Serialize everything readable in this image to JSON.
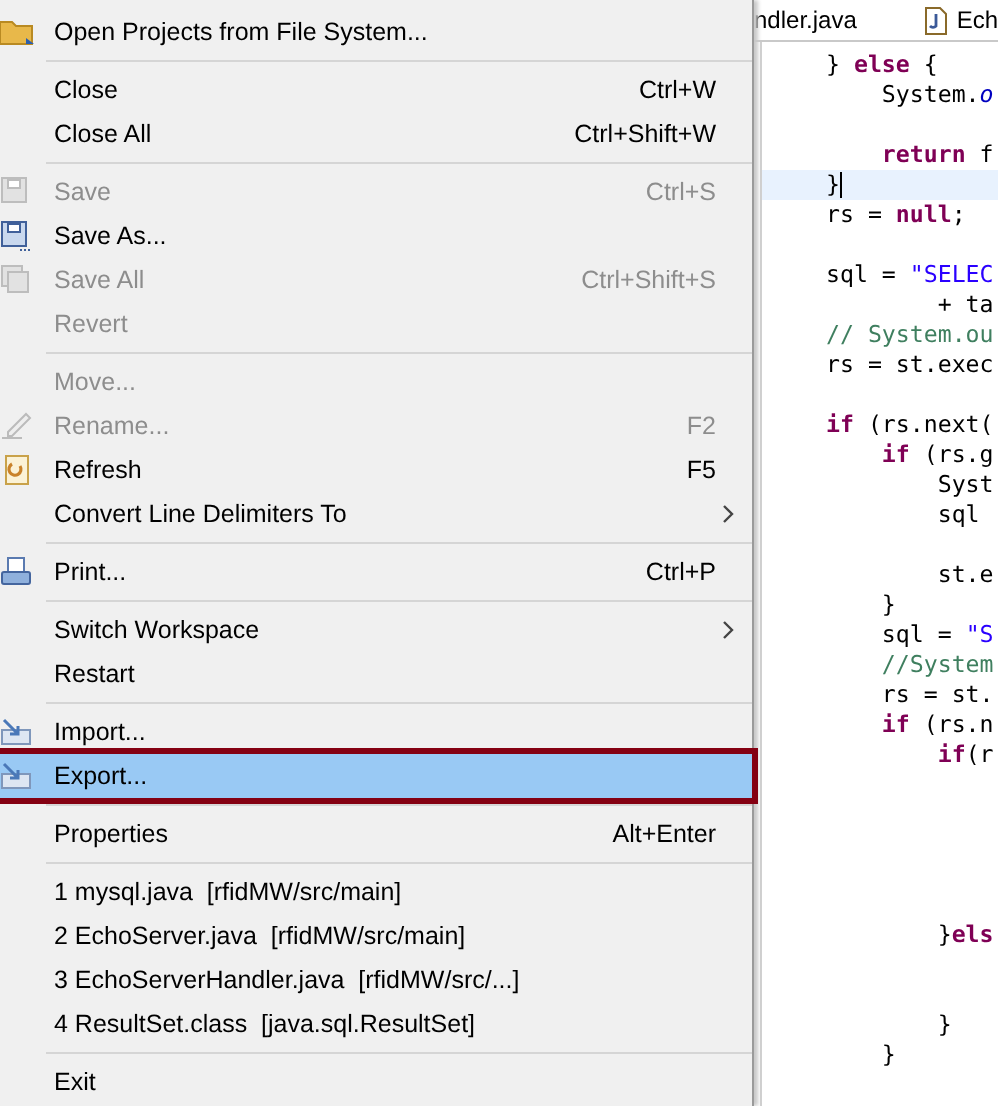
{
  "menu": {
    "sections": [
      [
        {
          "label": "Open Projects from File System...",
          "disabled": false,
          "selected": false,
          "submenu": false
        }
      ],
      [
        {
          "label": "Close",
          "shortcut": "Ctrl+W",
          "disabled": false,
          "selected": false,
          "submenu": false
        },
        {
          "label": "Close All",
          "shortcut": "Ctrl+Shift+W",
          "disabled": false,
          "selected": false,
          "submenu": false
        }
      ],
      [
        {
          "label": "Save",
          "shortcut": "Ctrl+S",
          "disabled": true,
          "selected": false,
          "submenu": false
        },
        {
          "label": "Save As...",
          "disabled": false,
          "selected": false,
          "submenu": false
        },
        {
          "label": "Save All",
          "shortcut": "Ctrl+Shift+S",
          "disabled": true,
          "selected": false,
          "submenu": false
        },
        {
          "label": "Revert",
          "disabled": true,
          "selected": false,
          "submenu": false
        }
      ],
      [
        {
          "label": "Move...",
          "disabled": true,
          "selected": false,
          "submenu": false
        },
        {
          "label": "Rename...",
          "shortcut": "F2",
          "disabled": true,
          "selected": false,
          "submenu": false
        },
        {
          "label": "Refresh",
          "shortcut": "F5",
          "disabled": false,
          "selected": false,
          "submenu": false
        },
        {
          "label": "Convert Line Delimiters To",
          "disabled": false,
          "selected": false,
          "submenu": true
        }
      ],
      [
        {
          "label": "Print...",
          "shortcut": "Ctrl+P",
          "disabled": false,
          "selected": false,
          "submenu": false
        }
      ],
      [
        {
          "label": "Switch Workspace",
          "disabled": false,
          "selected": false,
          "submenu": true
        },
        {
          "label": "Restart",
          "disabled": false,
          "selected": false,
          "submenu": false
        }
      ],
      [
        {
          "label": "Import...",
          "disabled": false,
          "selected": false,
          "submenu": false
        },
        {
          "label": "Export...",
          "disabled": false,
          "selected": true,
          "submenu": false
        }
      ],
      [
        {
          "label": "Properties",
          "shortcut": "Alt+Enter",
          "disabled": false,
          "selected": false,
          "submenu": false
        }
      ],
      [
        {
          "label": "1 mysql.java  [rfidMW/src/main]",
          "disabled": false,
          "selected": false,
          "submenu": false
        },
        {
          "label": "2 EchoServer.java  [rfidMW/src/main]",
          "disabled": false,
          "selected": false,
          "submenu": false
        },
        {
          "label": "3 EchoServerHandler.java  [rfidMW/src/...]",
          "disabled": false,
          "selected": false,
          "submenu": false
        },
        {
          "label": "4 ResultSet.class  [java.sql.ResultSet]",
          "disabled": false,
          "selected": false,
          "submenu": false
        }
      ],
      [
        {
          "label": "Exit",
          "disabled": false,
          "selected": false,
          "submenu": false
        }
      ]
    ]
  },
  "editor": {
    "tabs": [
      {
        "label": "ndler.java",
        "icon": false
      },
      {
        "label": "Ech",
        "icon": true
      }
    ],
    "lines": [
      {
        "current": false,
        "tokens": [
          {
            "kind": "plain",
            "text": "} "
          },
          {
            "kind": "keyword",
            "text": "else"
          },
          {
            "kind": "plain",
            "text": " {"
          }
        ]
      },
      {
        "current": false,
        "tokens": [
          {
            "kind": "plain",
            "text": "    System."
          },
          {
            "kind": "field",
            "text": "o"
          }
        ]
      },
      {
        "current": false
      },
      {
        "current": false,
        "tokens": [
          {
            "kind": "keyword",
            "text": "    return"
          },
          {
            "kind": "plain",
            "text": " f"
          }
        ]
      },
      {
        "current": true,
        "tokens": [
          {
            "kind": "plain",
            "text": "}"
          }
        ]
      },
      {
        "current": false,
        "tokens": [
          {
            "kind": "plain",
            "text": "rs = "
          },
          {
            "kind": "keyword",
            "text": "null"
          },
          {
            "kind": "plain",
            "text": ";"
          }
        ]
      },
      {
        "current": false
      },
      {
        "current": false,
        "tokens": [
          {
            "kind": "plain",
            "text": "sql = "
          },
          {
            "kind": "string",
            "text": "\"SELEC"
          }
        ]
      },
      {
        "current": false,
        "tokens": [
          {
            "kind": "plain",
            "text": "        + ta"
          }
        ]
      },
      {
        "current": false,
        "tokens": [
          {
            "kind": "comment",
            "text": "// System.ou"
          }
        ]
      },
      {
        "current": false,
        "tokens": [
          {
            "kind": "plain",
            "text": "rs = st.exec"
          }
        ]
      },
      {
        "current": false
      },
      {
        "current": false,
        "tokens": [
          {
            "kind": "keyword",
            "text": "if"
          },
          {
            "kind": "plain",
            "text": " (rs.next("
          }
        ]
      },
      {
        "current": false,
        "tokens": [
          {
            "kind": "keyword",
            "text": "    if"
          },
          {
            "kind": "plain",
            "text": " (rs.g"
          }
        ]
      },
      {
        "current": false,
        "tokens": [
          {
            "kind": "plain",
            "text": "        Syst"
          }
        ]
      },
      {
        "current": false,
        "tokens": [
          {
            "kind": "plain",
            "text": "        sql"
          }
        ]
      },
      {
        "current": false
      },
      {
        "current": false,
        "tokens": [
          {
            "kind": "plain",
            "text": "        st.e"
          }
        ]
      },
      {
        "current": false,
        "tokens": [
          {
            "kind": "plain",
            "text": "    }"
          }
        ]
      },
      {
        "current": false,
        "tokens": [
          {
            "kind": "plain",
            "text": "    sql = "
          },
          {
            "kind": "string",
            "text": "\"S"
          }
        ]
      },
      {
        "current": false,
        "tokens": [
          {
            "kind": "comment",
            "text": "    //System"
          }
        ]
      },
      {
        "current": false,
        "tokens": [
          {
            "kind": "plain",
            "text": "    rs = st."
          }
        ]
      },
      {
        "current": false,
        "tokens": [
          {
            "kind": "keyword",
            "text": "    if"
          },
          {
            "kind": "plain",
            "text": " (rs.n"
          }
        ]
      },
      {
        "current": false,
        "tokens": [
          {
            "kind": "keyword",
            "text": "        if"
          },
          {
            "kind": "plain",
            "text": "(r"
          }
        ]
      },
      {
        "current": false
      },
      {
        "current": false
      },
      {
        "current": false
      },
      {
        "current": false
      },
      {
        "current": false
      },
      {
        "current": false,
        "tokens": [
          {
            "kind": "plain",
            "text": "        }"
          },
          {
            "kind": "keyword",
            "text": "els"
          }
        ]
      },
      {
        "current": false
      },
      {
        "current": false
      },
      {
        "current": false,
        "tokens": [
          {
            "kind": "plain",
            "text": "        }"
          }
        ]
      },
      {
        "current": false,
        "tokens": [
          {
            "kind": "plain",
            "text": "    }"
          }
        ]
      }
    ]
  }
}
